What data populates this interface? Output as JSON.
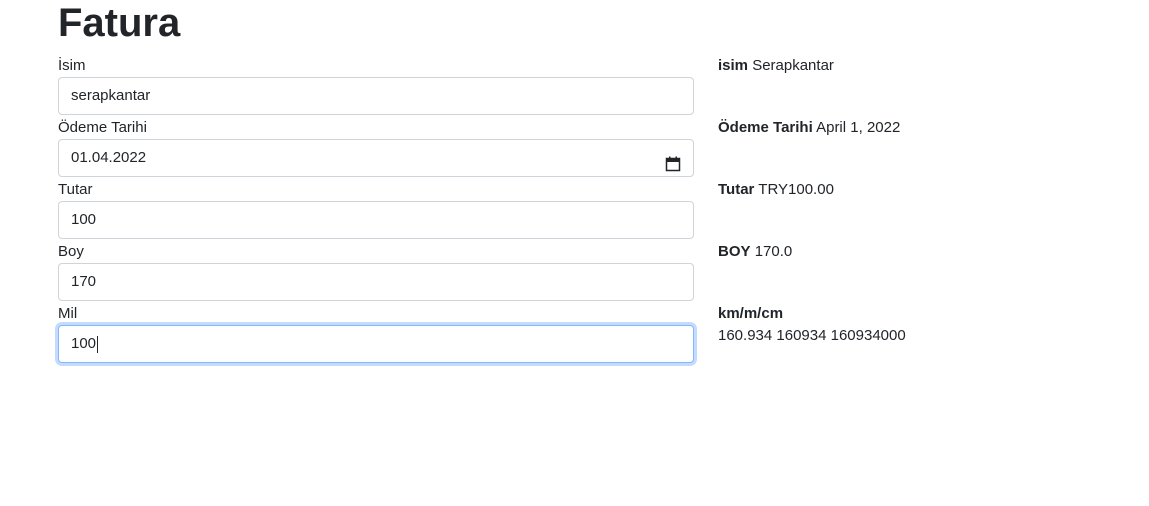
{
  "page": {
    "title": "Fatura"
  },
  "form": {
    "name": {
      "label": "İsim",
      "value": "serapkantar"
    },
    "date": {
      "label": "Ödeme Tarihi",
      "value": "01.04.2022",
      "icon": "calendar-icon"
    },
    "amount": {
      "label": "Tutar",
      "value": "100"
    },
    "height": {
      "label": "Boy",
      "value": "170"
    },
    "mile": {
      "label": "Mil",
      "value": "100"
    }
  },
  "output": {
    "name": {
      "label": "isim",
      "value": "Serapkantar"
    },
    "date": {
      "label": "Ödeme Tarihi",
      "value": "April 1, 2022"
    },
    "amount": {
      "label": "Tutar",
      "value": "TRY100.00"
    },
    "height": {
      "label": "BOY",
      "value": "170.0"
    },
    "distance": {
      "label": "km/m/cm",
      "value": "160.934 160934 160934000"
    }
  },
  "colors": {
    "focus_border": "#86b7fe",
    "text": "#212529",
    "border": "#ced4da"
  }
}
